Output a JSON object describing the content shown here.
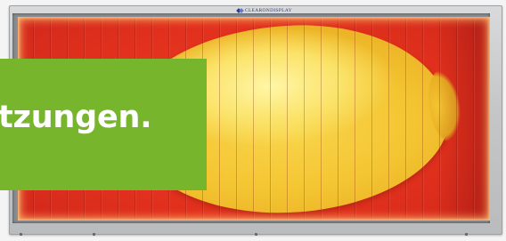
{
  "display_case": {
    "brand_label": "CLEARONDISPLAY",
    "poster_colors": {
      "background": "#e0301d",
      "fruit": "#f4c532"
    }
  },
  "banner": {
    "text": "tzungen.",
    "background_color": "#77b52d",
    "text_color": "#ffffff"
  }
}
